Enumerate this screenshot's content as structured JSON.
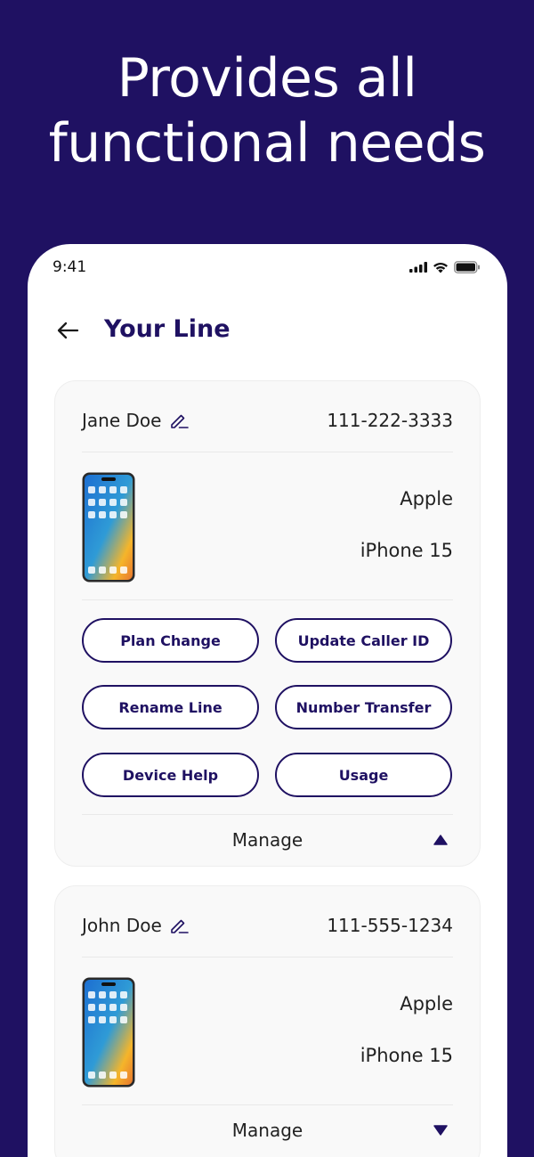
{
  "headline": {
    "line1": "Provides all",
    "line2": "functional needs"
  },
  "status_bar": {
    "time": "9:41",
    "icons": [
      "signal-icon",
      "wifi-icon",
      "battery-icon"
    ]
  },
  "nav": {
    "back_icon": "arrow-left-icon",
    "title": "Your Line"
  },
  "colors": {
    "background": "#1f1162",
    "accent": "#1f1162",
    "card": "#f9f9f9",
    "text": "#222222"
  },
  "lines": [
    {
      "name": "Jane Doe",
      "number": "111-222-3333",
      "device_brand": "Apple",
      "device_model": "iPhone 15",
      "expanded": true,
      "actions": [
        "Plan Change",
        "Update Caller ID",
        "Rename Line",
        "Number Transfer",
        "Device Help",
        "Usage"
      ],
      "manage_label": "Manage",
      "toggle_icon": "caret-up-icon"
    },
    {
      "name": "John Doe",
      "number": "111-555-1234",
      "device_brand": "Apple",
      "device_model": "iPhone 15",
      "expanded": false,
      "manage_label": "Manage",
      "toggle_icon": "caret-down-icon"
    }
  ]
}
